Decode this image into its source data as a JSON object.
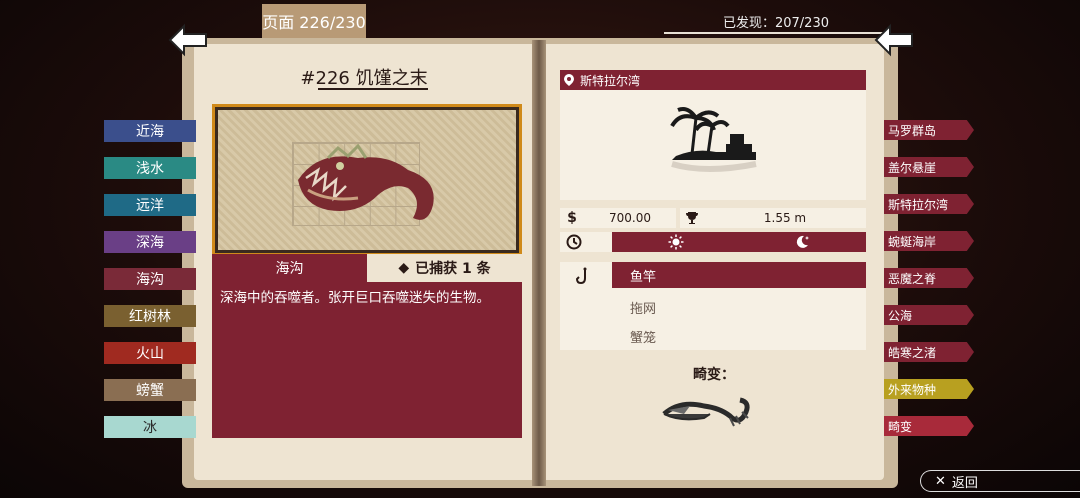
{
  "header": {
    "page_label": "页面 226/230",
    "discovered_label": "已发现：207/230"
  },
  "left_page": {
    "fish_title": "#226 饥馑之末",
    "habitat": "海沟",
    "caught_icon": "◆",
    "caught_label": "已捕获 1 条",
    "description": "深海中的吞噬者。张开巨口吞噬迷失的生物。"
  },
  "left_tabs": [
    {
      "label": "近海",
      "color": "#3b4f8c"
    },
    {
      "label": "浅水",
      "color": "#2a8a84"
    },
    {
      "label": "远洋",
      "color": "#1f6a86"
    },
    {
      "label": "深海",
      "color": "#6a3f86"
    },
    {
      "label": "海沟",
      "color": "#7a2a38"
    },
    {
      "label": "红树林",
      "color": "#7a6030"
    },
    {
      "label": "火山",
      "color": "#a02a20"
    },
    {
      "label": "螃蟹",
      "color": "#8a6e52"
    },
    {
      "label": "冰",
      "color": "#a8d8d0"
    }
  ],
  "right_page": {
    "location": "斯特拉尔湾",
    "location_icon": "map-pin-icon",
    "price_icon": "$",
    "price": "700.00",
    "trophy_icon": "trophy-icon",
    "size": "1.55 m",
    "time_icons": [
      "clock-icon",
      "sun-icon",
      "moon-icon"
    ],
    "gear": {
      "icon": "hook-icon",
      "items": [
        "鱼竿",
        "拖网",
        "蟹笼"
      ],
      "selected": "鱼竿"
    },
    "aberration_title": "畸变："
  },
  "right_tabs": [
    {
      "label": "马罗群岛",
      "color": "#7f2232"
    },
    {
      "label": "盖尔悬崖",
      "color": "#7f2232"
    },
    {
      "label": "斯特拉尔湾",
      "color": "#7f2232"
    },
    {
      "label": "蜿蜒海岸",
      "color": "#7f2232"
    },
    {
      "label": "恶魔之脊",
      "color": "#7f2232"
    },
    {
      "label": "公海",
      "color": "#7f2232"
    },
    {
      "label": "皓寒之渚",
      "color": "#7f2232"
    },
    {
      "label": "外来物种",
      "color": "#b8a020"
    },
    {
      "label": "畸变",
      "color": "#a82a3a"
    }
  ],
  "back_button": {
    "icon": "✕",
    "label": "返回"
  }
}
